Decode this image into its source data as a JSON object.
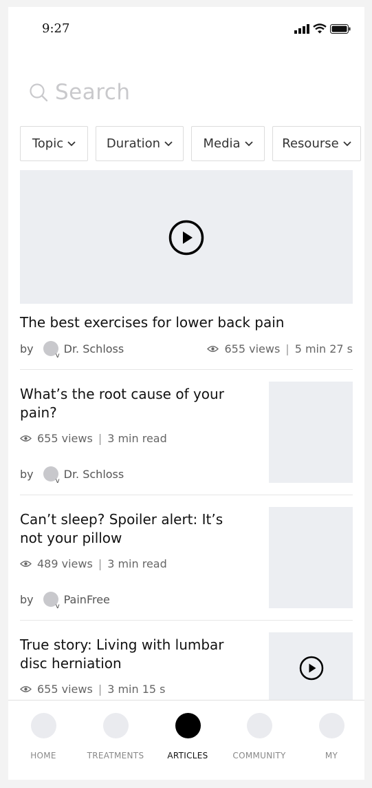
{
  "status_bar": {
    "time": "9:27"
  },
  "search": {
    "placeholder": "Search"
  },
  "filters": [
    {
      "label": "Topic"
    },
    {
      "label": "Duration"
    },
    {
      "label": "Media"
    },
    {
      "label": "Resourse"
    }
  ],
  "featured": {
    "title": "The best exercises for lower back pain",
    "by_label": "by",
    "author": "Dr. Schloss",
    "views": "655 views",
    "duration": "5 min 27 s"
  },
  "articles": [
    {
      "title_line1": "What’s the root cause of your",
      "title_line2": "pain?",
      "views": "655 views",
      "read_time": "3 min read",
      "by_label": "by",
      "author": "Dr. Schloss"
    },
    {
      "title_line1": "Can’t sleep? Spoiler alert: It’s",
      "title_line2": "not your pillow",
      "views": "489 views",
      "read_time": "3 min read",
      "by_label": "by",
      "author": "PainFree"
    },
    {
      "title_line1": "True story: Living with lumbar",
      "title_line2": "disc herniation",
      "views": "655 views",
      "read_time": "3 min 15 s"
    }
  ],
  "bottom_nav": [
    {
      "label": "HOME",
      "active": false
    },
    {
      "label": "TREATMENTS",
      "active": false
    },
    {
      "label": "ARTICLES",
      "active": true
    },
    {
      "label": "COMMUNITY",
      "active": false
    },
    {
      "label": "MY",
      "active": false
    }
  ],
  "colors": {
    "placeholder_gray": "#eceef2",
    "active_nav": "#000000"
  }
}
